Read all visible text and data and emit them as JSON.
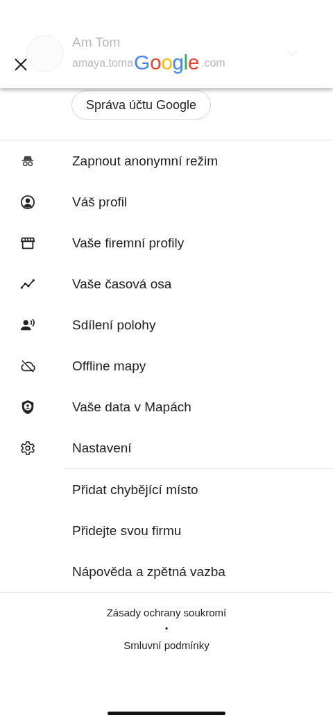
{
  "header": {
    "logo": "Google",
    "account_name": "Am Tom",
    "account_email_start": "amaya.toma",
    "account_email_end": ".com"
  },
  "manage_account_button": "Správa účtu Google",
  "menu_items": [
    {
      "kind": "incognito",
      "label": "Zapnout anonymní režim"
    },
    {
      "kind": "profile",
      "label": "Váš profil"
    },
    {
      "kind": "store",
      "label": "Vaše firemní profily"
    },
    {
      "kind": "timeline",
      "label": "Vaše časová osa"
    },
    {
      "kind": "location-sharing",
      "label": "Sdílení polohy"
    },
    {
      "kind": "offline",
      "label": "Offline mapy"
    },
    {
      "kind": "data",
      "label": "Vaše data v Mapách"
    },
    {
      "kind": "settings",
      "label": "Nastavení"
    }
  ],
  "secondary_items": [
    "Přidat chybějící místo",
    "Přidejte svou firmu",
    "Nápověda a zpětná vazba"
  ],
  "footer": {
    "links": [
      "Zásady ochrany soukromí",
      "Smluvní podmínky"
    ],
    "separator": "•"
  }
}
